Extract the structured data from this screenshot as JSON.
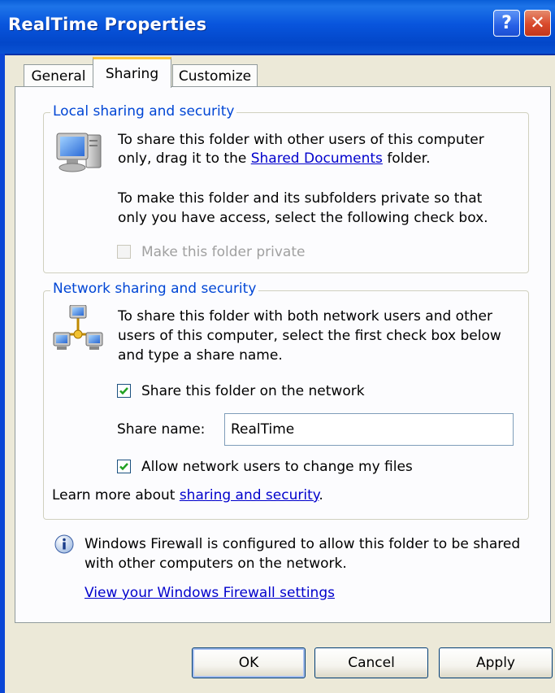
{
  "window": {
    "title": "RealTime Properties",
    "help_glyph": "?",
    "close_glyph": "✕"
  },
  "tabs": [
    {
      "label": "General",
      "selected": false
    },
    {
      "label": "Sharing",
      "selected": true
    },
    {
      "label": "Customize",
      "selected": false
    }
  ],
  "local": {
    "title": "Local sharing and security",
    "line1": "To share this folder with other users of this computer",
    "line2_prefix": "only, drag it to the ",
    "line2_link": "Shared Documents",
    "line2_suffix": " folder.",
    "line3": "To make this folder and its subfolders private so that",
    "line4": "only you have access, select the following check box.",
    "private_checkbox_label": "Make this folder private",
    "private_checked": false,
    "private_enabled": false
  },
  "network": {
    "title": "Network sharing and security",
    "line1": "To share this folder with both network users and other",
    "line2": "users of this computer, select the first check box below",
    "line3": "and type a share name.",
    "share_checkbox_label": "Share this folder on the network",
    "share_checked": true,
    "share_name_label": "Share name:",
    "share_name_value": "RealTime",
    "allow_change_label": "Allow network users to change my files",
    "allow_change_checked": true,
    "learn_more_prefix": "Learn more about ",
    "learn_more_link": "sharing and security",
    "learn_more_suffix": "."
  },
  "firewall": {
    "line1": "Windows Firewall is configured to allow this folder to be shared",
    "line2": "with other computers on the network.",
    "settings_link": "View your Windows Firewall settings"
  },
  "buttons": {
    "ok": "OK",
    "cancel": "Cancel",
    "apply": "Apply"
  },
  "colors": {
    "titlebar": "#0A5FD8",
    "link": "#0000CC",
    "group_title": "#0046D5",
    "panel_bg": "#FCFCFE",
    "dialog_bg": "#ECE9D8"
  }
}
